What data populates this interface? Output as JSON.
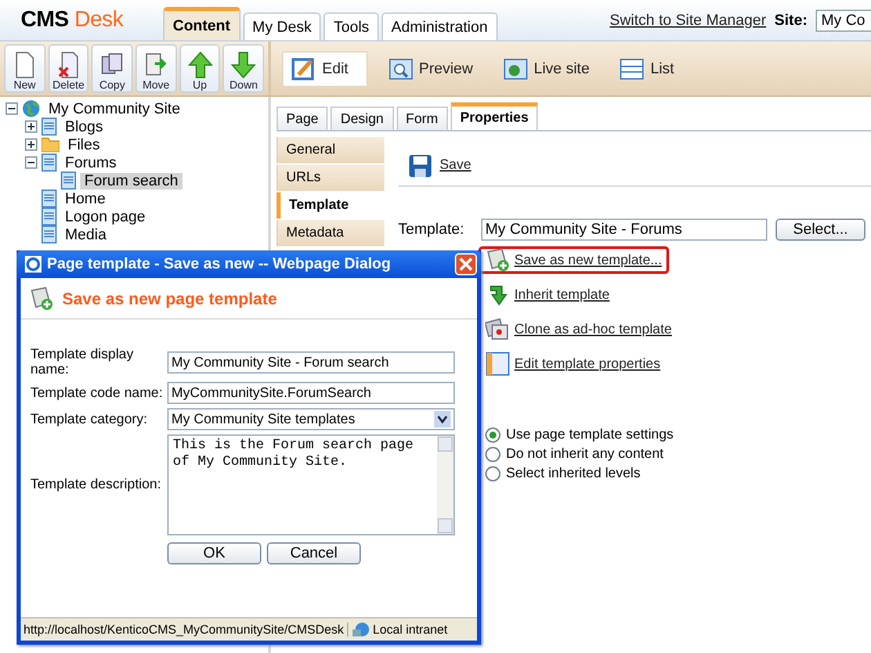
{
  "header": {
    "logo_main": "CMS",
    "logo_accent": "Desk",
    "tabs": [
      {
        "label": "Content",
        "selected": true
      },
      {
        "label": "My Desk",
        "selected": false
      },
      {
        "label": "Tools",
        "selected": false
      },
      {
        "label": "Administration",
        "selected": false
      }
    ],
    "switch_link": "Switch to Site Manager",
    "site_label": "Site:",
    "site_value": "My Co"
  },
  "toolbar": {
    "actions": [
      {
        "label": "New",
        "kind": "new"
      },
      {
        "label": "Delete",
        "kind": "delete"
      },
      {
        "label": "Copy",
        "kind": "copy"
      },
      {
        "label": "Move",
        "kind": "move"
      },
      {
        "label": "Up",
        "kind": "up"
      },
      {
        "label": "Down",
        "kind": "down"
      }
    ],
    "views": [
      {
        "label": "Edit",
        "kind": "edit",
        "selected": true
      },
      {
        "label": "Preview",
        "kind": "preview",
        "selected": false
      },
      {
        "label": "Live site",
        "kind": "live",
        "selected": false
      },
      {
        "label": "List",
        "kind": "list",
        "selected": false
      }
    ]
  },
  "tree": [
    {
      "label": "My Community Site",
      "kind": "site",
      "expanded": true,
      "selected": false,
      "children": [
        {
          "label": "Blogs",
          "kind": "doc",
          "expanded": false,
          "selected": false
        },
        {
          "label": "Files",
          "kind": "folder",
          "expanded": false,
          "selected": false
        },
        {
          "label": "Forums",
          "kind": "doc",
          "expanded": true,
          "selected": false,
          "children": [
            {
              "label": "Forum search",
              "kind": "doc",
              "selected": true
            }
          ]
        },
        {
          "label": "Home",
          "kind": "doc",
          "selected": false
        },
        {
          "label": "Logon page",
          "kind": "doc",
          "selected": false
        },
        {
          "label": "Media",
          "kind": "doc",
          "selected": false
        }
      ]
    }
  ],
  "page_tabs": [
    {
      "label": "Page",
      "selected": false
    },
    {
      "label": "Design",
      "selected": false
    },
    {
      "label": "Form",
      "selected": false
    },
    {
      "label": "Properties",
      "selected": true
    }
  ],
  "side_menu": [
    {
      "label": "General",
      "selected": false
    },
    {
      "label": "URLs",
      "selected": false
    },
    {
      "label": "Template",
      "selected": true
    },
    {
      "label": "Metadata",
      "selected": false
    }
  ],
  "save_label": "Save",
  "template": {
    "label": "Template:",
    "value": "My Community Site - Forums",
    "button": "Select..."
  },
  "template_actions": [
    {
      "label": "Save as new template...",
      "kind": "save-new",
      "highlighted": true
    },
    {
      "label": "Inherit template",
      "kind": "inherit",
      "highlighted": false
    },
    {
      "label": "Clone as ad-hoc template",
      "kind": "clone",
      "highlighted": false
    },
    {
      "label": "Edit template properties",
      "kind": "props",
      "highlighted": false
    }
  ],
  "inheritance": [
    {
      "label": "Use page template settings",
      "selected": true
    },
    {
      "label": "Do not inherit any content",
      "selected": false
    },
    {
      "label": "Select inherited levels",
      "selected": false
    }
  ],
  "dialog": {
    "title": "Page template - Save as new -- Webpage Dialog",
    "heading": "Save as new page template",
    "fields": [
      {
        "label": "Template display name:",
        "value": "My Community Site - Forum search",
        "kind": "text"
      },
      {
        "label": "Template code name:",
        "value": "MyCommunitySite.ForumSearch",
        "kind": "text"
      },
      {
        "label": "Template category:",
        "value": "My Community Site templates",
        "kind": "select"
      },
      {
        "label": "Template description:",
        "value": "This is the Forum search page of My Community Site.",
        "kind": "textarea"
      }
    ],
    "buttons": [
      "OK",
      "Cancel"
    ],
    "status_url": "http://localhost/KenticoCMS_MyCommunitySite/CMSDesk",
    "status_zone": "Local intranet"
  }
}
